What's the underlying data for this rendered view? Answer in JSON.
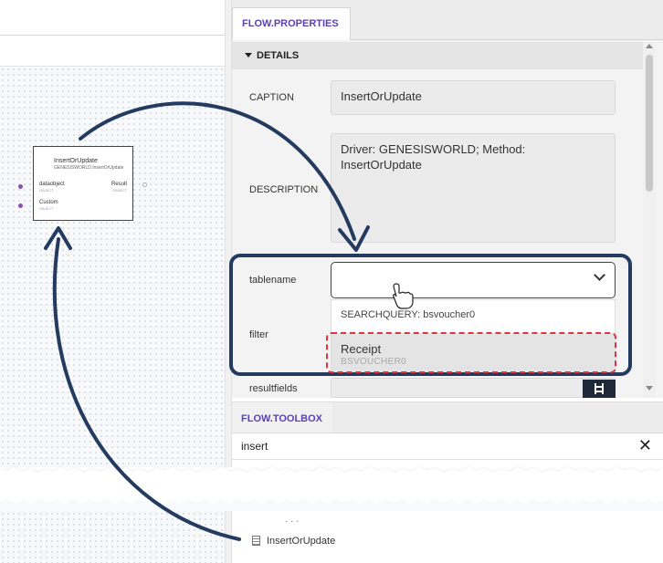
{
  "properties": {
    "tab_label": "FLOW.PROPERTIES",
    "section_label": "DETAILS",
    "fields": {
      "caption_label": "CAPTION",
      "caption_value": "InsertOrUpdate",
      "description_label": "DESCRIPTION",
      "description_value": "Driver: GENESISWORLD; Method: InsertOrUpdate",
      "tablename_label": "tablename",
      "tablename_value": "",
      "filter_label": "filter",
      "resultfields_label": "resultfields"
    },
    "dropdown": {
      "group_label": "SEARCHQUERY: bsvoucher0",
      "option_name": "Receipt",
      "option_sub": "BSVOUCHER0"
    }
  },
  "node": {
    "title": "InsertOrUpdate",
    "subtitle": "GENESISWORLD.InsertOrUpdate",
    "input1_label": "dataobject",
    "input1_type": "OBJECT",
    "input2_label": "Custom",
    "input2_type": "OBJECT",
    "output_label": "Result",
    "output_type": "OBJECT"
  },
  "toolbox": {
    "tab_label": "FLOW.TOOLBOX",
    "search_value": "insert",
    "close_glyph": "✕",
    "dots": "· · ·",
    "item_label": "InsertOrUpdate"
  },
  "colors": {
    "accent_purple": "#5b3fb4",
    "callout_navy": "#243a5e",
    "highlight_red": "#e03340"
  }
}
